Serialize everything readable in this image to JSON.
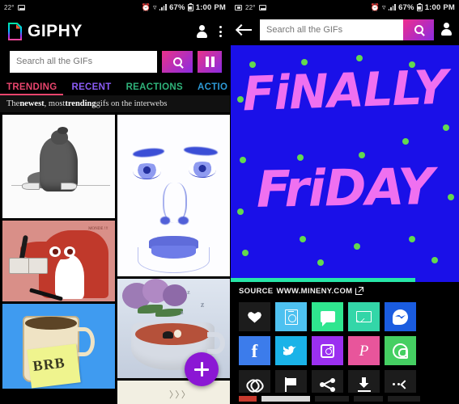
{
  "status_bar": {
    "temp": "22°",
    "battery_pct": "67%",
    "time": "1:00 PM",
    "icons": [
      "screenshot-icon",
      "alarm-icon",
      "wifi-icon",
      "signal-icon",
      "battery-icon"
    ]
  },
  "left_panel": {
    "app_name": "GIPHY",
    "header_icons": [
      "account-icon",
      "overflow-menu-icon"
    ],
    "search": {
      "placeholder": "Search all the GIFs",
      "value": "",
      "submit_label": "search-icon",
      "pause_label": "pause-icon"
    },
    "tabs": [
      {
        "label": "TRENDING",
        "color": "#e8456d",
        "active": true
      },
      {
        "label": "RECENT",
        "color": "#8b5cf6",
        "active": false
      },
      {
        "label": "REACTIONS",
        "color": "#2fb37a",
        "active": false
      },
      {
        "label": "ACTIO",
        "color": "#2d9ad6",
        "active": false
      }
    ],
    "banner": {
      "part1": "The ",
      "bold1": "newest",
      "part2": ", most ",
      "bold2": "trending",
      "part3": " gifs on the interwebs"
    },
    "grid_items": [
      {
        "name": "pencil-sketch-girl-on-phone"
      },
      {
        "name": "blue-pencil-face-portrait"
      },
      {
        "name": "red-fox-reading-book"
      },
      {
        "name": "lilac-teacup-bather"
      },
      {
        "name": "brb-coffee-mug-sticky-note",
        "text": "BRB"
      },
      {
        "name": "cream-paper-partial"
      }
    ],
    "fab_label": "+"
  },
  "right_panel": {
    "back_label": "back-arrow-icon",
    "search": {
      "placeholder": "Search all the GIFs",
      "value": "",
      "submit_label": "search-icon"
    },
    "account_label": "account-icon",
    "gif": {
      "line1": "FiNALLY",
      "line2": "FriDAY",
      "bg_color": "#1a10e8",
      "text_color": "#ef70f0",
      "dot_color": "#63d94f"
    },
    "progress": {
      "percent": 81,
      "color": "#27e6a8"
    },
    "source": {
      "label": "SOURCE",
      "url": "WWW.MINENY.COM",
      "icon": "external-link-icon"
    },
    "share_tiles": [
      {
        "name": "favorite-heart",
        "glyph": "heart",
        "bg": "#1c1c1c",
        "label": ""
      },
      {
        "name": "giphy-scan",
        "glyph": "doc",
        "bg": "#4ec1f0",
        "label": ""
      },
      {
        "name": "sms-message",
        "glyph": "bubble",
        "bg": "#2fe68f",
        "label": ""
      },
      {
        "name": "email",
        "glyph": "mail",
        "bg": "#33d6a8",
        "label": ""
      },
      {
        "name": "facebook-messenger",
        "glyph": "msgr",
        "bg": "#1a5ce0",
        "label": ""
      },
      {
        "name": "facebook",
        "glyph": "fb",
        "bg": "#3c7ceb",
        "label": "f"
      },
      {
        "name": "twitter",
        "glyph": "tw",
        "bg": "#1ab3e8",
        "label": ""
      },
      {
        "name": "instagram",
        "glyph": "ig",
        "bg": "#9b30f0",
        "label": ""
      },
      {
        "name": "pinterest",
        "glyph": "pin",
        "bg": "#e8559b",
        "label": "𝒫"
      },
      {
        "name": "whatsapp",
        "glyph": "wa",
        "bg": "#45cf62",
        "label": ""
      },
      {
        "name": "copy-link",
        "glyph": "link",
        "bg": "#1c1c1c",
        "label": ""
      },
      {
        "name": "report-flag",
        "glyph": "flag",
        "bg": "#1c1c1c",
        "label": ""
      },
      {
        "name": "share",
        "glyph": "share",
        "bg": "#1c1c1c",
        "label": ""
      },
      {
        "name": "download",
        "glyph": "dl",
        "bg": "#1c1c1c",
        "label": ""
      },
      {
        "name": "more-options",
        "glyph": "more",
        "bg": "#1c1c1c",
        "label": ""
      }
    ]
  }
}
